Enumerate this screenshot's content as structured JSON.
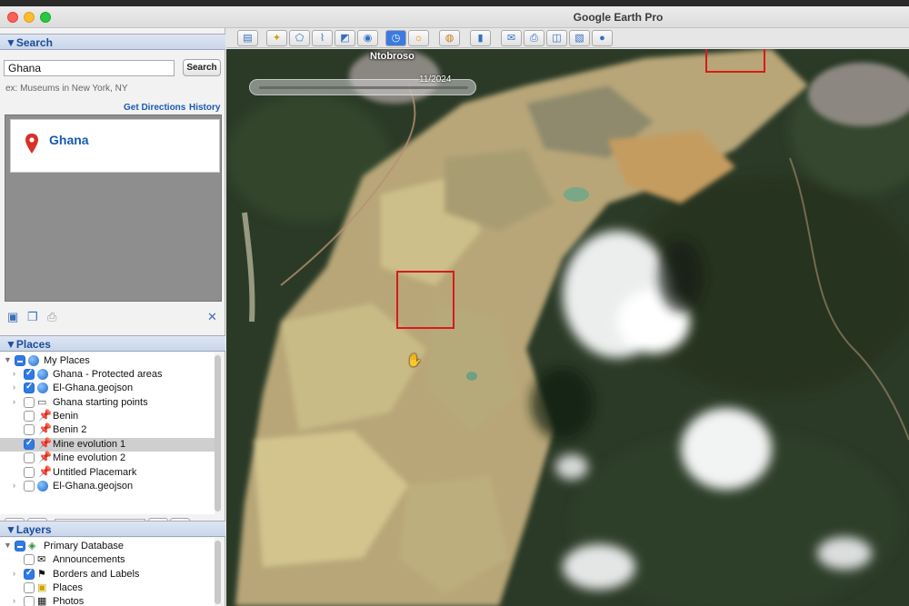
{
  "window": {
    "title": "Google Earth Pro"
  },
  "search": {
    "header": "▼Search",
    "query": "Ghana",
    "button": "Search",
    "hint": "ex: Museums in New York, NY",
    "get_directions": "Get Directions",
    "history": "History",
    "result": "Ghana"
  },
  "places": {
    "header": "▼Places",
    "items": [
      {
        "label": "My Places",
        "icon": "globe-icon",
        "check": "mixed"
      },
      {
        "label": "Ghana - Protected areas",
        "icon": "globe-icon",
        "check": "on"
      },
      {
        "label": "El-Ghana.geojson",
        "icon": "globe-icon",
        "check": "on"
      },
      {
        "label": "Ghana starting points",
        "icon": "folder-icon",
        "check": "off"
      },
      {
        "label": "Benin",
        "icon": "pin-icon",
        "check": "off"
      },
      {
        "label": "Benin 2",
        "icon": "pin-icon",
        "check": "off"
      },
      {
        "label": "Mine evolution 1",
        "icon": "pin-icon",
        "check": "on"
      },
      {
        "label": "Mine evolution 2",
        "icon": "pin-icon",
        "check": "off"
      },
      {
        "label": "Untitled Placemark",
        "icon": "pin-icon",
        "check": "off"
      },
      {
        "label": "El-Ghana.geojson",
        "icon": "globe-icon",
        "check": "off"
      }
    ]
  },
  "layers": {
    "header": "▼Layers",
    "items": [
      {
        "label": "Primary Database",
        "check": "mixed"
      },
      {
        "label": "Announcements",
        "check": "off"
      },
      {
        "label": "Borders and Labels",
        "check": "on"
      },
      {
        "label": "Places",
        "check": "off"
      },
      {
        "label": "Photos",
        "check": "off"
      }
    ]
  },
  "map": {
    "place_label": "Ntobroso",
    "time_label": "11/2024"
  },
  "colors": {
    "accent": "#2f7ae5",
    "link": "#1a5ab4",
    "highlight_box": "#d61b1b"
  }
}
